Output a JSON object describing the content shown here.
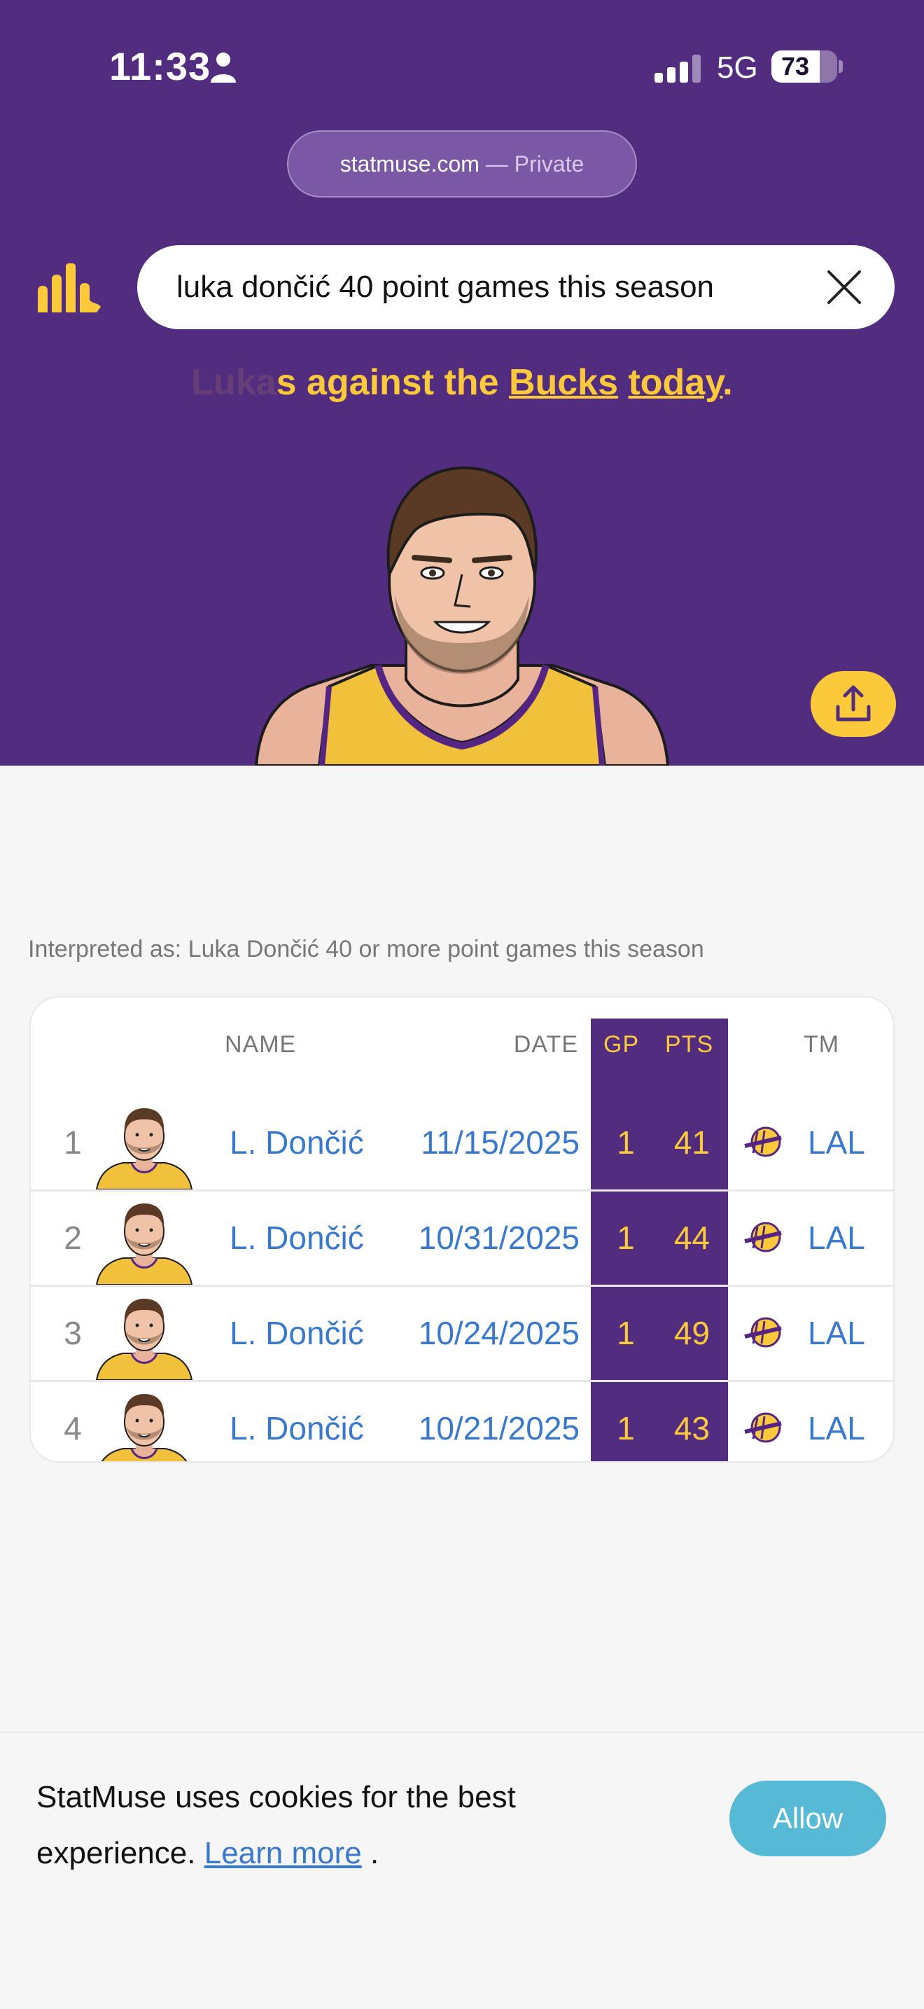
{
  "status_bar": {
    "time": "11:33",
    "network": "5G",
    "battery": "73",
    "battery_level": 0.73
  },
  "browser": {
    "domain": "statmuse.com",
    "mode": " — Private"
  },
  "search": {
    "query": "luka dončić 40 point games this season"
  },
  "answer": {
    "faded_text": "Luka",
    "text_before": "s against the ",
    "link_team": "Bucks",
    "text_middle": " ",
    "link_when": "today",
    "text_after": "."
  },
  "interpreted": "Interpreted as: Luka Dončić 40 or more point games this season",
  "table": {
    "headers": {
      "name": "NAME",
      "date": "DATE",
      "gp": "GP",
      "pts": "PTS",
      "tm": "TM"
    },
    "rows": [
      {
        "rank": "1",
        "name": "L. Dončić",
        "date": "11/15/2025",
        "gp": "1",
        "pts": "41",
        "team": "LAL"
      },
      {
        "rank": "2",
        "name": "L. Dončić",
        "date": "10/31/2025",
        "gp": "1",
        "pts": "44",
        "team": "LAL"
      },
      {
        "rank": "3",
        "name": "L. Dončić",
        "date": "10/24/2025",
        "gp": "1",
        "pts": "49",
        "team": "LAL"
      },
      {
        "rank": "4",
        "name": "L. Dončić",
        "date": "10/21/2025",
        "gp": "1",
        "pts": "43",
        "team": "LAL"
      }
    ]
  },
  "cookie": {
    "text_line": "StatMuse uses cookies for the best experience.",
    "link": "Learn more",
    "text_end": ".",
    "button": "Allow"
  },
  "colors": {
    "brand_purple": "#522d7f",
    "gold": "#fcc93a",
    "link_blue": "#3879cf",
    "allow_teal": "#56b9d6"
  },
  "icons": [
    "person-icon",
    "signal-icon",
    "statmuse-logo",
    "clear-icon",
    "share-icon",
    "lakers-logo"
  ]
}
